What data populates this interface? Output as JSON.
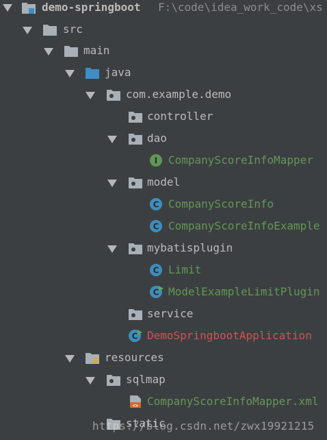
{
  "project": {
    "name": "demo-springboot",
    "path": "F:\\code\\idea_work_code\\xs"
  },
  "tree": {
    "src": "src",
    "main": "main",
    "java": "java",
    "package": "com.example.demo",
    "controller": "controller",
    "dao": "dao",
    "dao_mapper": "CompanyScoreInfoMapper",
    "model": "model",
    "model_info": "CompanyScoreInfo",
    "model_example": "CompanyScoreInfoExample",
    "mybatisplugin": "mybatisplugin",
    "plugin_limit": "Limit",
    "plugin_example": "ModelExampleLimitPlugin",
    "service": "service",
    "app": "DemoSpringbootApplication",
    "resources": "resources",
    "sqlmap": "sqlmap",
    "mapper_xml": "CompanyScoreInfoMapper.xml",
    "static": "static"
  },
  "watermark": "https://blog.csdn.net/zwx19921215",
  "colors": {
    "background": "#3c3f41",
    "folder": "#a9b0b6",
    "source_folder": "#3d8ec5",
    "class_icon": "#3f8dbd",
    "interface_icon": "#629755",
    "green_text": "#629755",
    "red_text": "#d25252"
  },
  "icons": {
    "module": "module-folder-icon",
    "folder": "folder-icon",
    "package": "package-icon",
    "source_root": "source-root-icon",
    "resources_root": "resources-root-icon",
    "class": "class-icon",
    "interface": "interface-icon",
    "runnable_class": "runnable-class-icon",
    "xml": "xml-file-icon"
  }
}
